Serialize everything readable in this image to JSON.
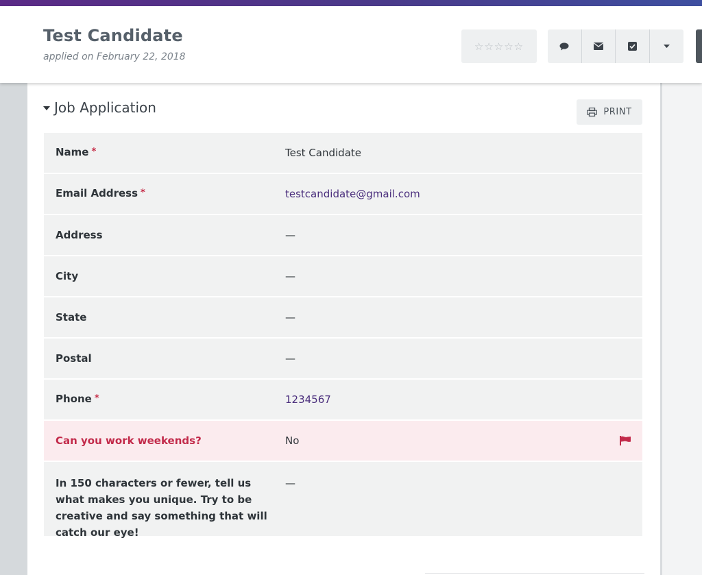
{
  "candidate": {
    "name": "Test Candidate",
    "applied": "applied on February 22, 2018"
  },
  "rating": {
    "stars": "☆☆☆☆☆"
  },
  "actions": [
    {
      "name": "comment-icon"
    },
    {
      "name": "email-icon"
    },
    {
      "name": "task-check-icon"
    },
    {
      "name": "dropdown-caret-icon"
    }
  ],
  "section": {
    "title": "Job Application",
    "print_label": "PRINT"
  },
  "fields": [
    {
      "label": "Name",
      "required": "*",
      "value": "Test Candidate"
    },
    {
      "label": "Email Address",
      "required": "*",
      "value": "testcandidate@gmail.com"
    },
    {
      "label": "Address",
      "required": "",
      "value": "—"
    },
    {
      "label": "City",
      "required": "",
      "value": "—"
    },
    {
      "label": "State",
      "required": "",
      "value": "—"
    },
    {
      "label": "Postal",
      "required": "",
      "value": "—"
    },
    {
      "label": "Phone",
      "required": "*",
      "value": "1234567"
    },
    {
      "label": "Can you work weekends?",
      "required": "",
      "value": "No"
    },
    {
      "label": "In 150 characters or fewer, tell us what makes you unique. Try to be creative and say something that will catch our eye!",
      "required": "",
      "value": "—"
    }
  ],
  "colors": {
    "accent": "#5b2a86",
    "link": "#4b2f7d",
    "flag": "#c22a4a",
    "row_bg": "#f1f2f2",
    "flag_row_bg": "#fbebee"
  }
}
